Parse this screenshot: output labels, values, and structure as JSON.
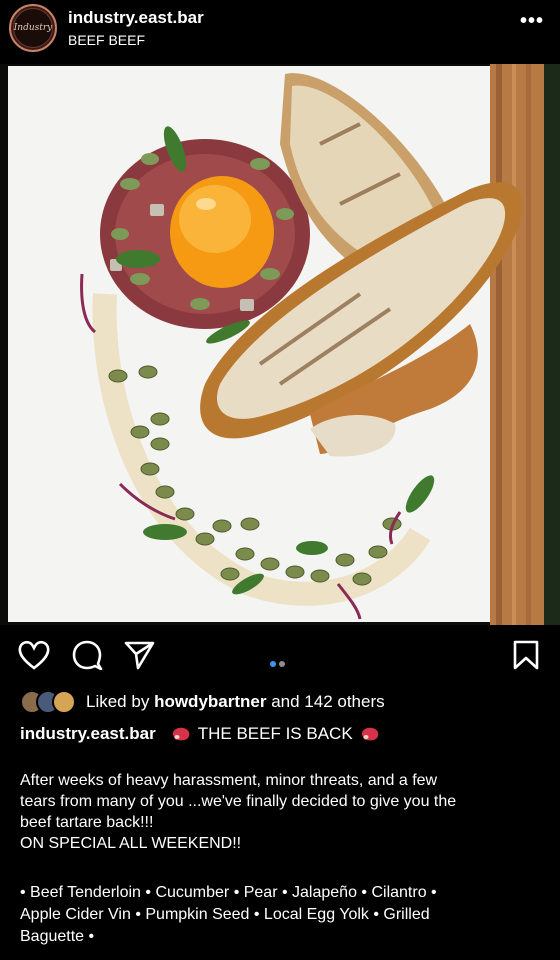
{
  "post": {
    "username": "industry.east.bar",
    "subtitle": "BEEF BEEF",
    "more_label": "•••",
    "avatar_text": "Industry"
  },
  "carousel": {
    "current": 1,
    "total": 2
  },
  "likes": {
    "prefix": "Liked by",
    "user": "howdybartner",
    "suffix": "and 142 others"
  },
  "caption": {
    "username": "industry.east.bar",
    "headline": "THE BEEF IS BACK",
    "emoji_icon": "steak-icon",
    "body_line1": "After weeks of heavy harassment, minor threats, and a few",
    "body_line2": "tears from many of you ...we've finally decided to give you the",
    "body_line3": "beef tartare back!!!",
    "body_line4": "ON SPECIAL ALL WEEKEND!!",
    "items_line1": "• Beef Tenderloin • Cucumber • Pear • Jalapeño • Cilantro •",
    "items_line2": "Apple Cider Vin • Pumpkin Seed • Local Egg Yolk • Grilled",
    "items_line3": "Baguette •"
  },
  "colors": {
    "accent_dot": "#3897f0",
    "inactive_dot": "#8e8e8e",
    "avatar_ring": "#c9826a"
  }
}
